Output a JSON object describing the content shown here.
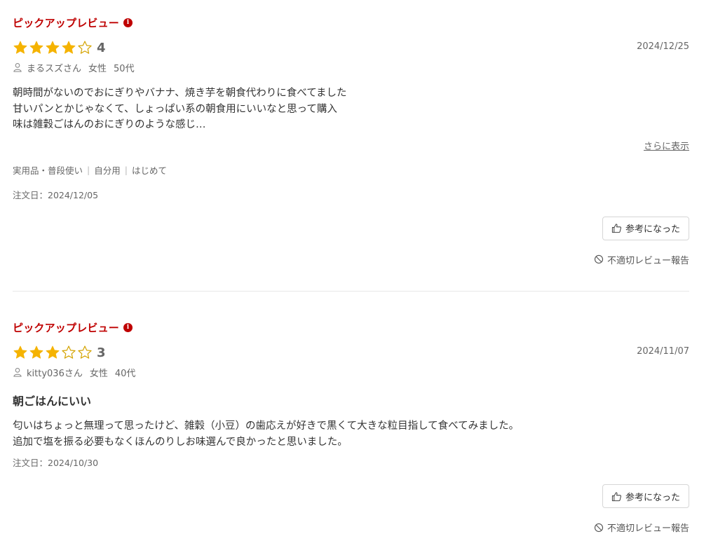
{
  "reviews": [
    {
      "pickup_label": "ピックアップレビュー",
      "info_icon": "i",
      "rating": 4,
      "rating_max": 5,
      "score_text": "4",
      "date": "2024/12/25",
      "reviewer_name": "まるスズさん",
      "reviewer_gender": "女性",
      "reviewer_age": "50代",
      "body": "朝時間がないのでおにぎりやバナナ、焼き芋を朝食代わりに食べてました\n甘いパンとかじゃなくて、しょっぱい系の朝食用にいいなと思って購入\n味は雑穀ごはんのおにぎりのような感じ…",
      "more_label": "さらに表示",
      "tags": [
        "実用品・普段使い",
        "自分用",
        "はじめて"
      ],
      "order_date": "注文日：2024/12/05",
      "helpful_label": "参考になった",
      "report_label": "不適切レビュー報告"
    },
    {
      "pickup_label": "ピックアップレビュー",
      "info_icon": "i",
      "rating": 3,
      "rating_max": 5,
      "score_text": "3",
      "date": "2024/11/07",
      "reviewer_name": "kitty036さん",
      "reviewer_gender": "女性",
      "reviewer_age": "40代",
      "title": "朝ごはんにいい",
      "body": "匂いはちょっと無理って思ったけど、雑穀（小豆）の歯応えが好きで黒くて大きな粒目指して食べてみました。\n追加で塩を振る必要もなくほんのりしお味選んで良かったと思いました。",
      "order_date": "注文日：2024/10/30",
      "helpful_label": "参考になった",
      "report_label": "不適切レビュー報告"
    }
  ],
  "colors": {
    "accent_red": "#bf0000",
    "star_filled": "#f5b301",
    "star_empty_stroke": "#d4a300"
  }
}
